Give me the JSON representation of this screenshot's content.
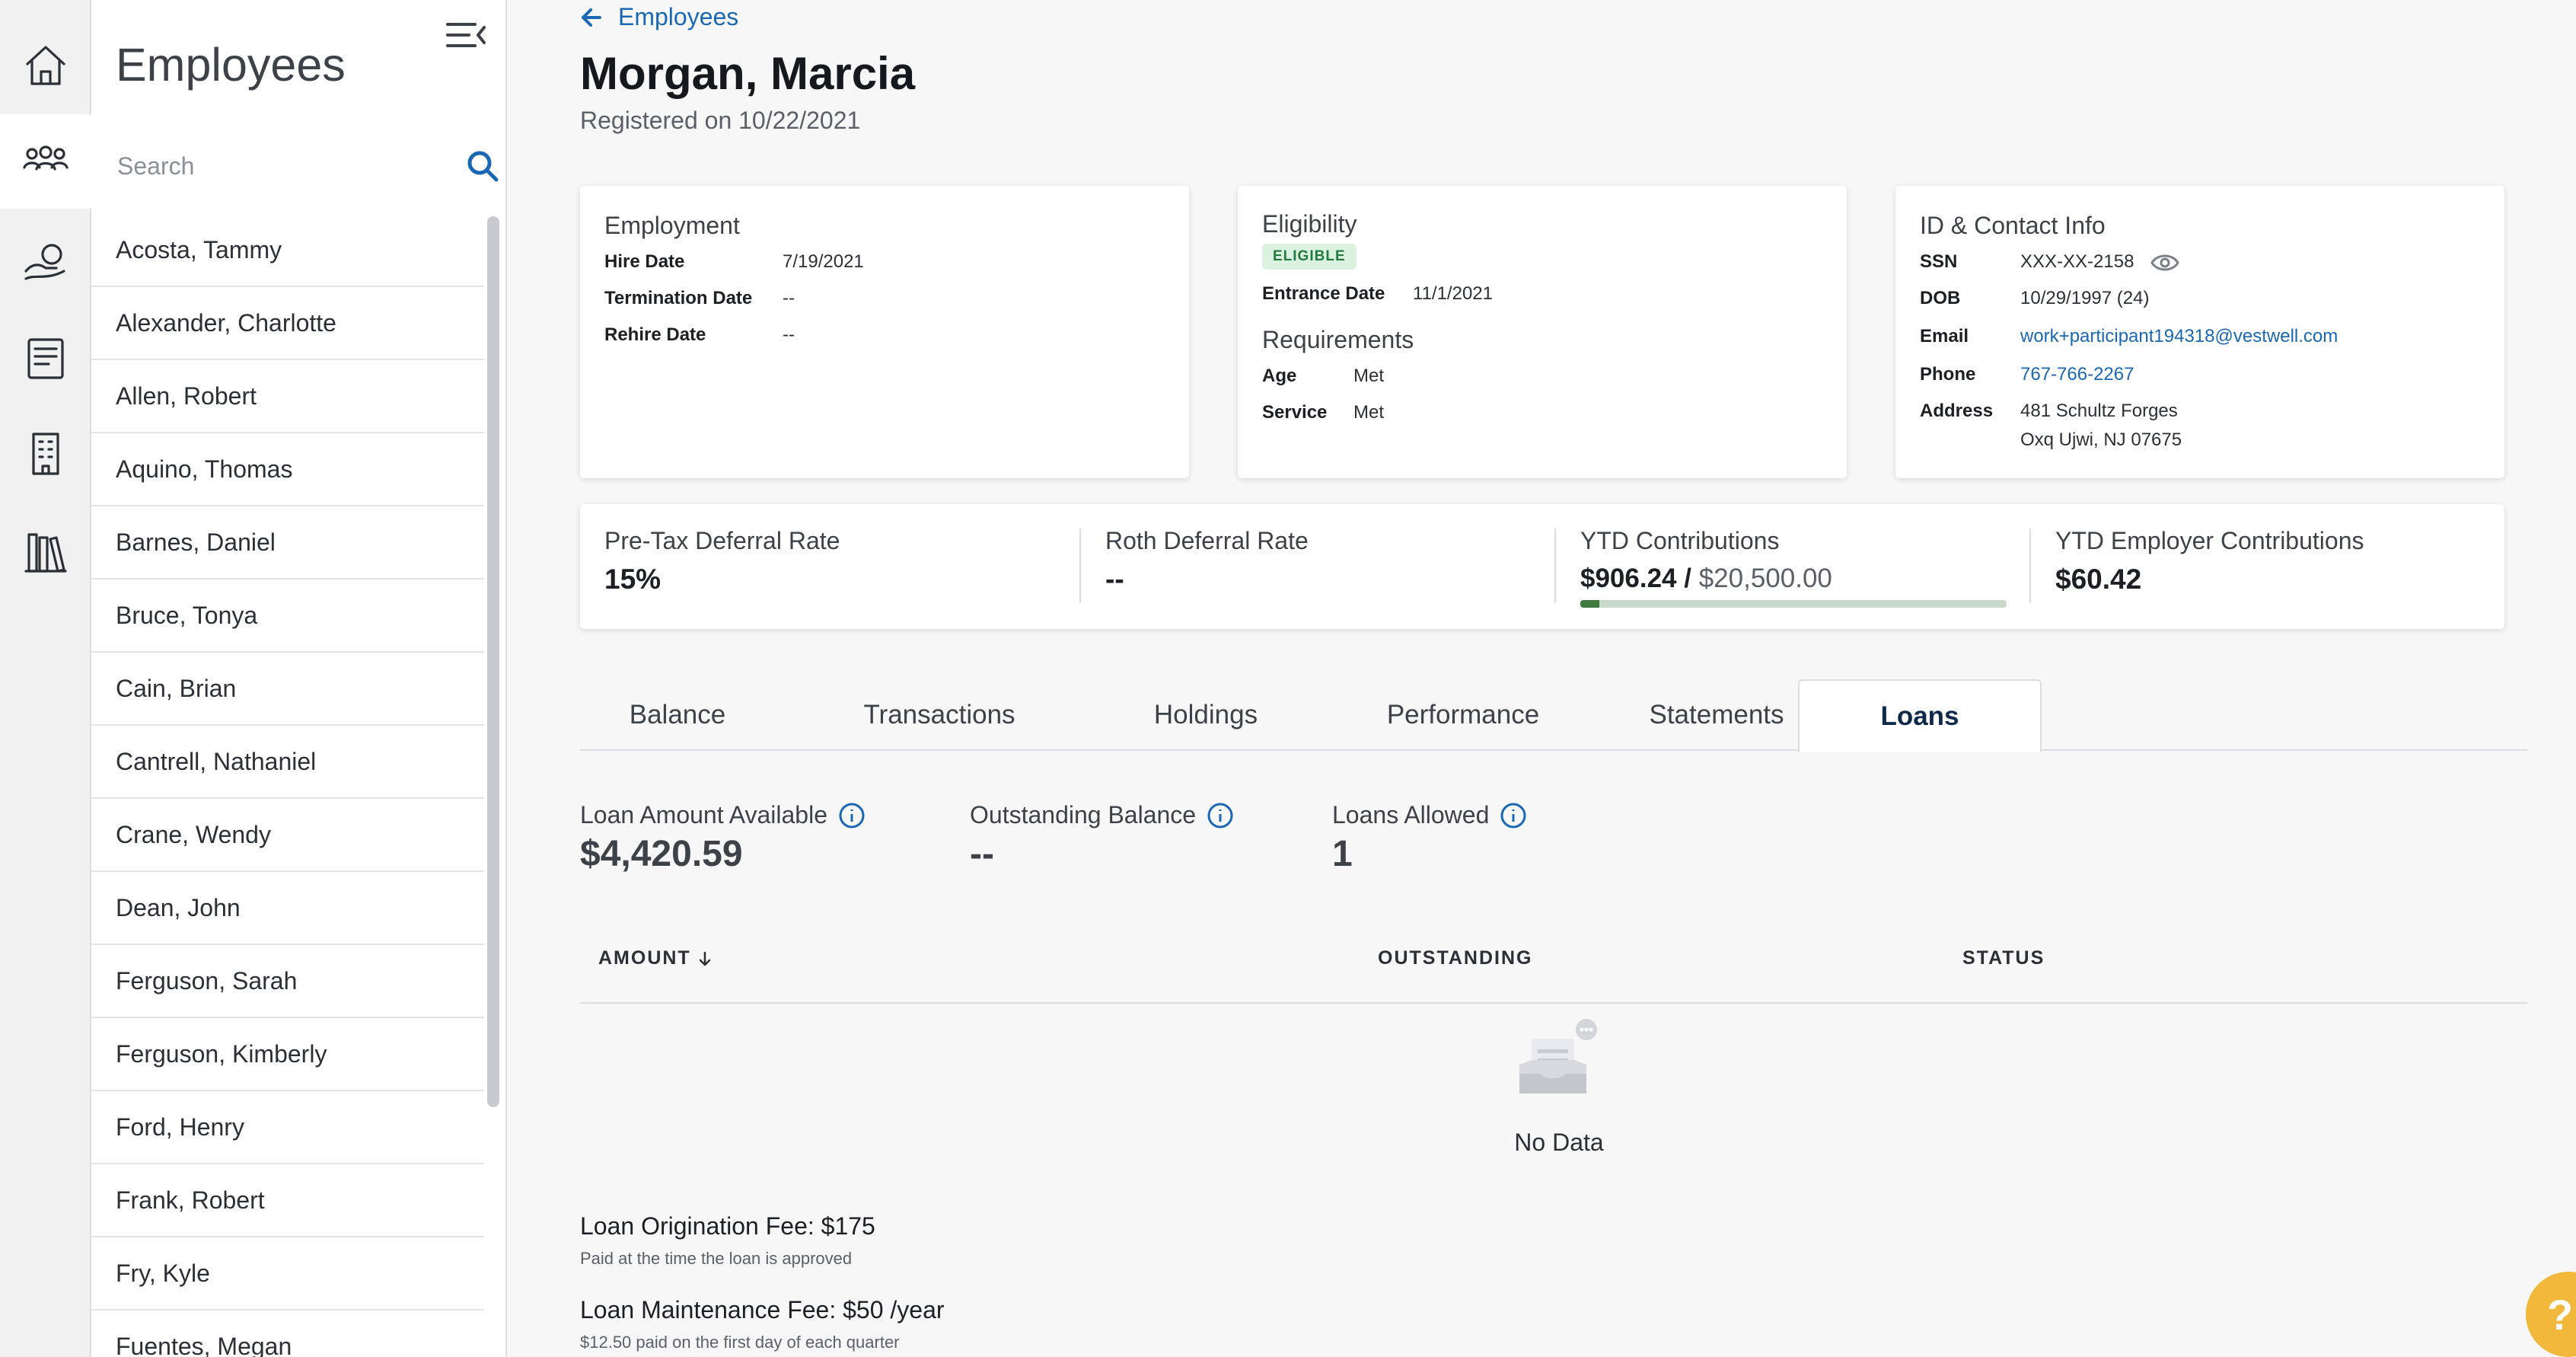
{
  "sidebar": {
    "title": "Employees",
    "search_placeholder": "Search",
    "employees": [
      "Acosta, Tammy",
      "Alexander, Charlotte",
      "Allen, Robert",
      "Aquino, Thomas",
      "Barnes, Daniel",
      "Bruce, Tonya",
      "Cain, Brian",
      "Cantrell, Nathaniel",
      "Crane, Wendy",
      "Dean, John",
      "Ferguson, Sarah",
      "Ferguson, Kimberly",
      "Ford, Henry",
      "Frank, Robert",
      "Fry, Kyle",
      "Fuentes, Megan"
    ]
  },
  "rail_icons": [
    "home-icon",
    "people-icon",
    "hand-coin-icon",
    "document-icon",
    "building-icon",
    "library-icon"
  ],
  "header": {
    "back_label": "Employees",
    "name": "Morgan, Marcia",
    "registered": "Registered on 10/22/2021"
  },
  "employment": {
    "title": "Employment",
    "hire_label": "Hire Date",
    "hire_value": "7/19/2021",
    "term_label": "Termination Date",
    "term_value": "--",
    "rehire_label": "Rehire Date",
    "rehire_value": "--"
  },
  "eligibility": {
    "title": "Eligibility",
    "badge": "ELIGIBLE",
    "entrance_label": "Entrance Date",
    "entrance_value": "11/1/2021",
    "req_title": "Requirements",
    "age_label": "Age",
    "age_value": "Met",
    "service_label": "Service",
    "service_value": "Met"
  },
  "contact": {
    "title": "ID & Contact Info",
    "ssn_label": "SSN",
    "ssn_value": "XXX-XX-2158",
    "dob_label": "DOB",
    "dob_value": "10/29/1997 (24)",
    "email_label": "Email",
    "email_value": "work+participant194318@vestwell.com",
    "phone_label": "Phone",
    "phone_value": "767-766-2267",
    "address_label": "Address",
    "address_line1": "481 Schultz Forges",
    "address_line2": "Oxq Ujwi, NJ 07675"
  },
  "stats": {
    "pretax_label": "Pre-Tax Deferral Rate",
    "pretax_value": "15%",
    "roth_label": "Roth Deferral Rate",
    "roth_value": "--",
    "ytd_label": "YTD Contributions",
    "ytd_value": "$906.24 /",
    "ytd_limit": "$20,500.00",
    "ytd_progress": 0.044,
    "employer_label": "YTD Employer Contributions",
    "employer_value": "$60.42"
  },
  "tabs": [
    "Balance",
    "Transactions",
    "Holdings",
    "Performance",
    "Statements",
    "Loans"
  ],
  "active_tab": "Loans",
  "loans": {
    "available_label": "Loan Amount Available",
    "available_value": "$4,420.59",
    "outstanding_label": "Outstanding Balance",
    "outstanding_value": "--",
    "allowed_label": "Loans Allowed",
    "allowed_value": "1",
    "columns": [
      "AMOUNT",
      "OUTSTANDING",
      "STATUS"
    ],
    "no_data": "No Data",
    "origination_fee": "Loan Origination Fee: $175",
    "origination_note": "Paid at the time the loan is approved",
    "maintenance_fee": "Loan Maintenance Fee: $50 /year",
    "maintenance_note": "$12.50 paid on the first day of each quarter"
  },
  "help_label": "?",
  "colors": {
    "accent": "#1a68b3",
    "eligible_bg": "#dcf2e1",
    "eligible_text": "#217a3c",
    "progress": "#3f7a3f",
    "help": "#f2b83b"
  }
}
